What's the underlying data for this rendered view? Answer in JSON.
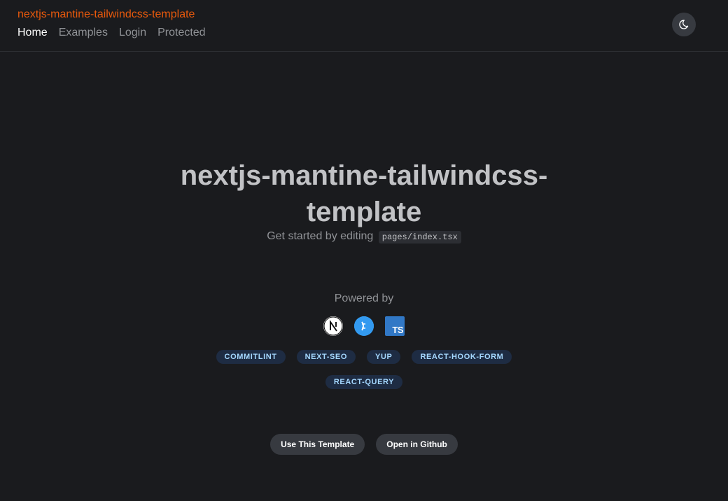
{
  "header": {
    "brand": "nextjs-mantine-tailwindcss-template",
    "nav": [
      {
        "label": "Home",
        "active": true
      },
      {
        "label": "Examples",
        "active": false
      },
      {
        "label": "Login",
        "active": false
      },
      {
        "label": "Protected",
        "active": false
      }
    ],
    "theme_toggle_icon": "moon-icon"
  },
  "hero": {
    "title_line1": "nextjs-mantine-tailwindcss-",
    "title_line2": "template",
    "subtitle": "Get started by editing",
    "code": "pages/index.tsx"
  },
  "powered": {
    "label": "Powered by",
    "logos": [
      "nextjs-logo-icon",
      "mantine-logo-icon",
      "typescript-logo-icon"
    ],
    "ts_text": "TS",
    "badges": [
      "COMMITLINT",
      "NEXT-SEO",
      "YUP",
      "REACT-HOOK-FORM",
      "REACT-QUERY"
    ]
  },
  "actions": {
    "use_template": "Use This Template",
    "open_github": "Open in Github"
  },
  "colors": {
    "background": "#1a1b1e",
    "brand": "#e8590c",
    "badge_bg": "#1e2c43",
    "badge_text": "#a5d8ff",
    "button_bg": "#373a40"
  }
}
